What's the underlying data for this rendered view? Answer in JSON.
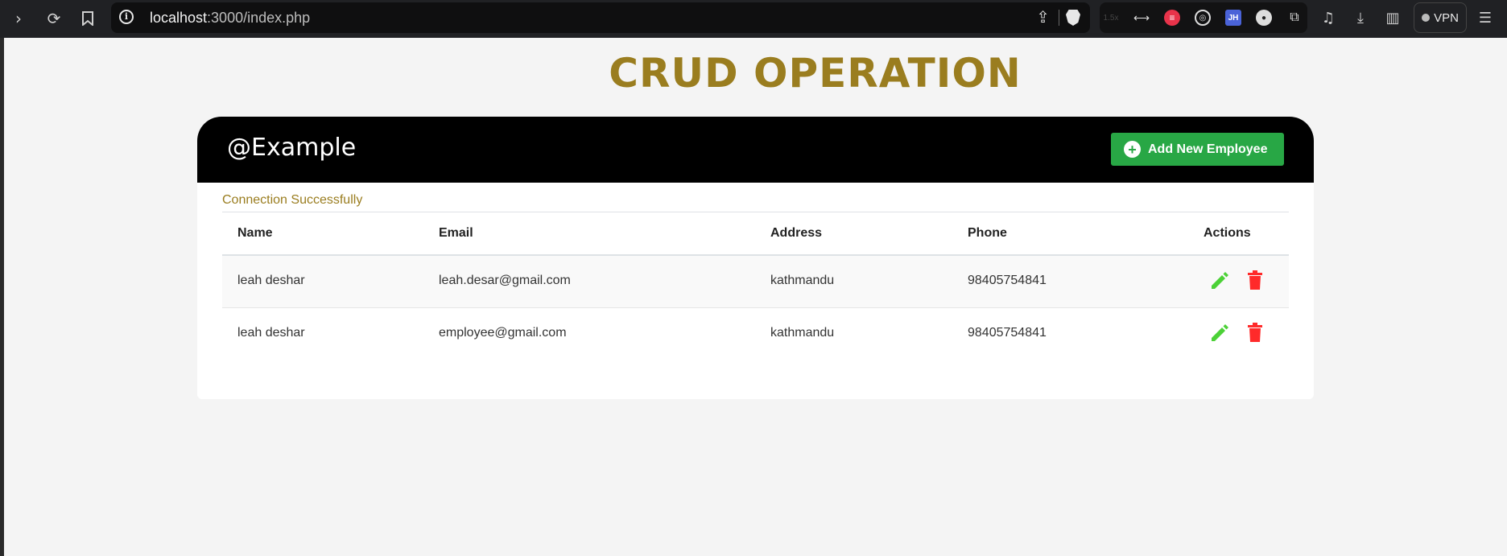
{
  "browser": {
    "url_host": "localhost",
    "url_path": ":3000/index.php",
    "extensions": [
      "1.5x",
      "JH"
    ],
    "vpn_label": "VPN"
  },
  "page": {
    "title": "CRUD OPERATION",
    "brand": "@Example",
    "add_button_label": "Add New Employee",
    "connection_message": "Connection Successfully"
  },
  "table": {
    "columns": [
      "Name",
      "Email",
      "Address",
      "Phone",
      "Actions"
    ],
    "rows": [
      {
        "name": "leah deshar",
        "email": "leah.desar@gmail.com",
        "address": "kathmandu",
        "phone": "98405754841"
      },
      {
        "name": "leah deshar",
        "email": "employee@gmail.com",
        "address": "kathmandu",
        "phone": "98405754841"
      }
    ]
  },
  "colors": {
    "title": "#9a7d1f",
    "add_button": "#28a745",
    "edit_icon": "#4cd137",
    "delete_icon": "#ff2a2a"
  },
  "icons": [
    "edit-icon",
    "delete-icon",
    "plus-circle-icon"
  ]
}
